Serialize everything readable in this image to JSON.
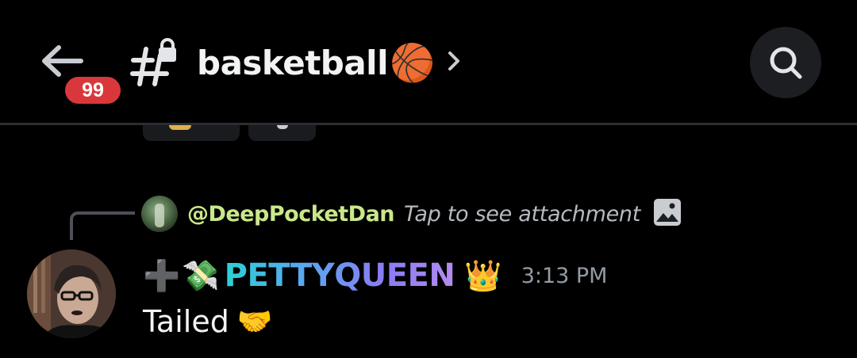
{
  "header": {
    "unread_count": "99",
    "channel_name": "basketball",
    "channel_emoji": "🏀",
    "back_icon": "arrow-left-icon",
    "channel_icon": "locked-hashtag-icon",
    "chevron_icon": "chevron-right-icon",
    "search_icon": "search-icon"
  },
  "reply": {
    "username": "@DeepPocketDan",
    "text": "Tap to see attachment",
    "attachment_icon": "image-icon"
  },
  "message": {
    "role_icon": "➕",
    "money_icon": "💸",
    "author": "PETTYQUEEN",
    "crown": "👑",
    "timestamp": "3:13 PM",
    "body": "Tailed",
    "body_emoji": "🤝"
  },
  "colors": {
    "background": "#000000",
    "badge": "#da373c",
    "reply_username": "#c9e88a",
    "timestamp": "#949ba4",
    "name_gradient_start": "#2ad1d6",
    "name_gradient_end": "#b48cf0"
  }
}
